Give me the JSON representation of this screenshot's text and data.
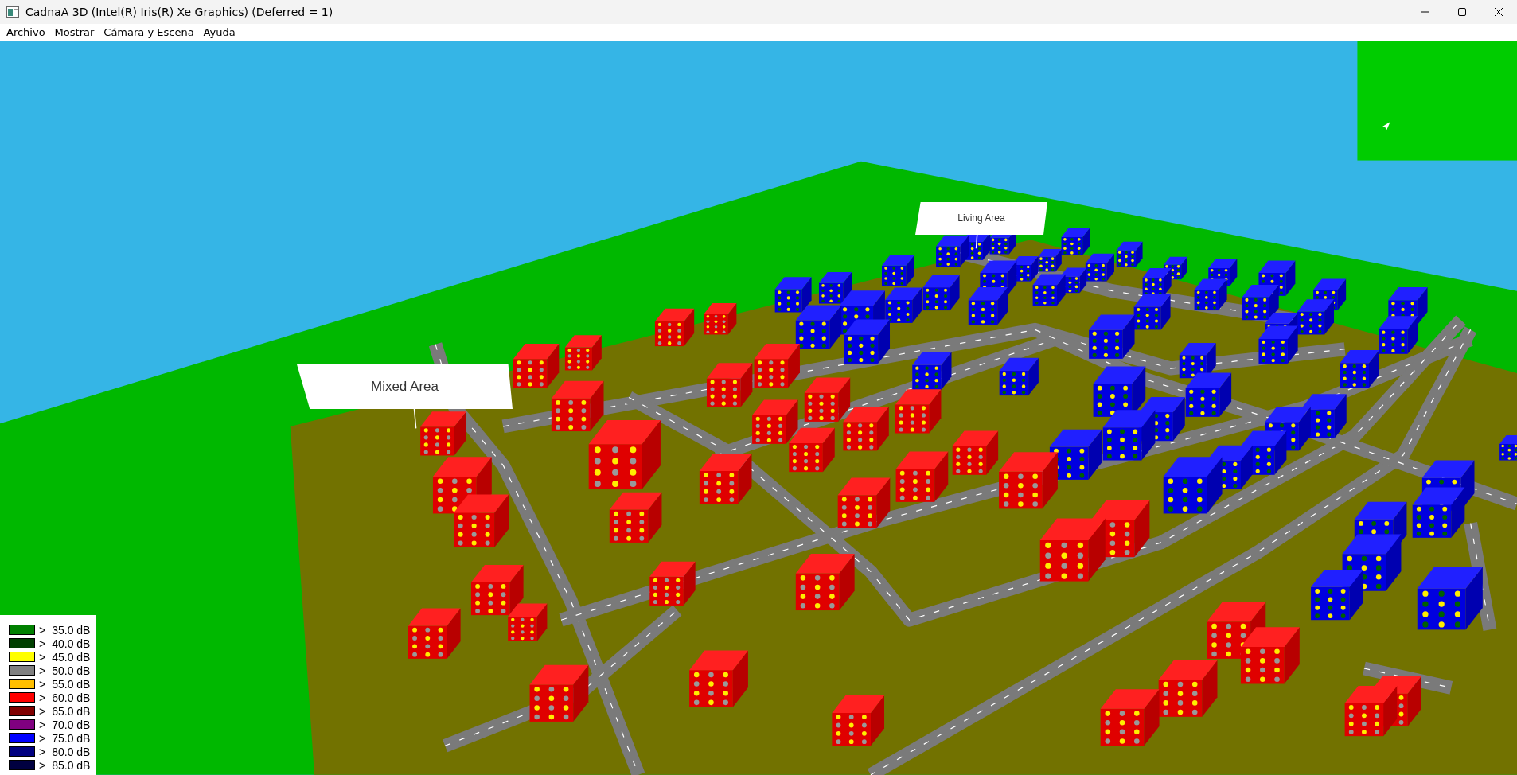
{
  "window": {
    "title": "CadnaA 3D (Intel(R) Iris(R) Xe Graphics) (Deferred = 1)"
  },
  "menu": [
    "Archivo",
    "Mostrar",
    "Cámara y Escena",
    "Ayuda"
  ],
  "scene": {
    "area_labels": [
      {
        "text": "Mixed Area",
        "kind": "large"
      },
      {
        "text": "Living Area",
        "kind": "small"
      }
    ]
  },
  "legend": [
    {
      "symbol": ">",
      "value": "35.0 dB",
      "color": "#008000"
    },
    {
      "symbol": ">",
      "value": "40.0 dB",
      "color": "#004000"
    },
    {
      "symbol": ">",
      "value": "45.0 dB",
      "color": "#ffff00"
    },
    {
      "symbol": ">",
      "value": "50.0 dB",
      "color": "#808080"
    },
    {
      "symbol": ">",
      "value": "55.0 dB",
      "color": "#ffbf00"
    },
    {
      "symbol": ">",
      "value": "60.0 dB",
      "color": "#ff0000"
    },
    {
      "symbol": ">",
      "value": "65.0 dB",
      "color": "#800000"
    },
    {
      "symbol": ">",
      "value": "70.0 dB",
      "color": "#800080"
    },
    {
      "symbol": ">",
      "value": "75.0 dB",
      "color": "#0000ff"
    },
    {
      "symbol": ">",
      "value": "80.0 dB",
      "color": "#000080"
    },
    {
      "symbol": ">",
      "value": "85.0 dB",
      "color": "#000040"
    }
  ]
}
